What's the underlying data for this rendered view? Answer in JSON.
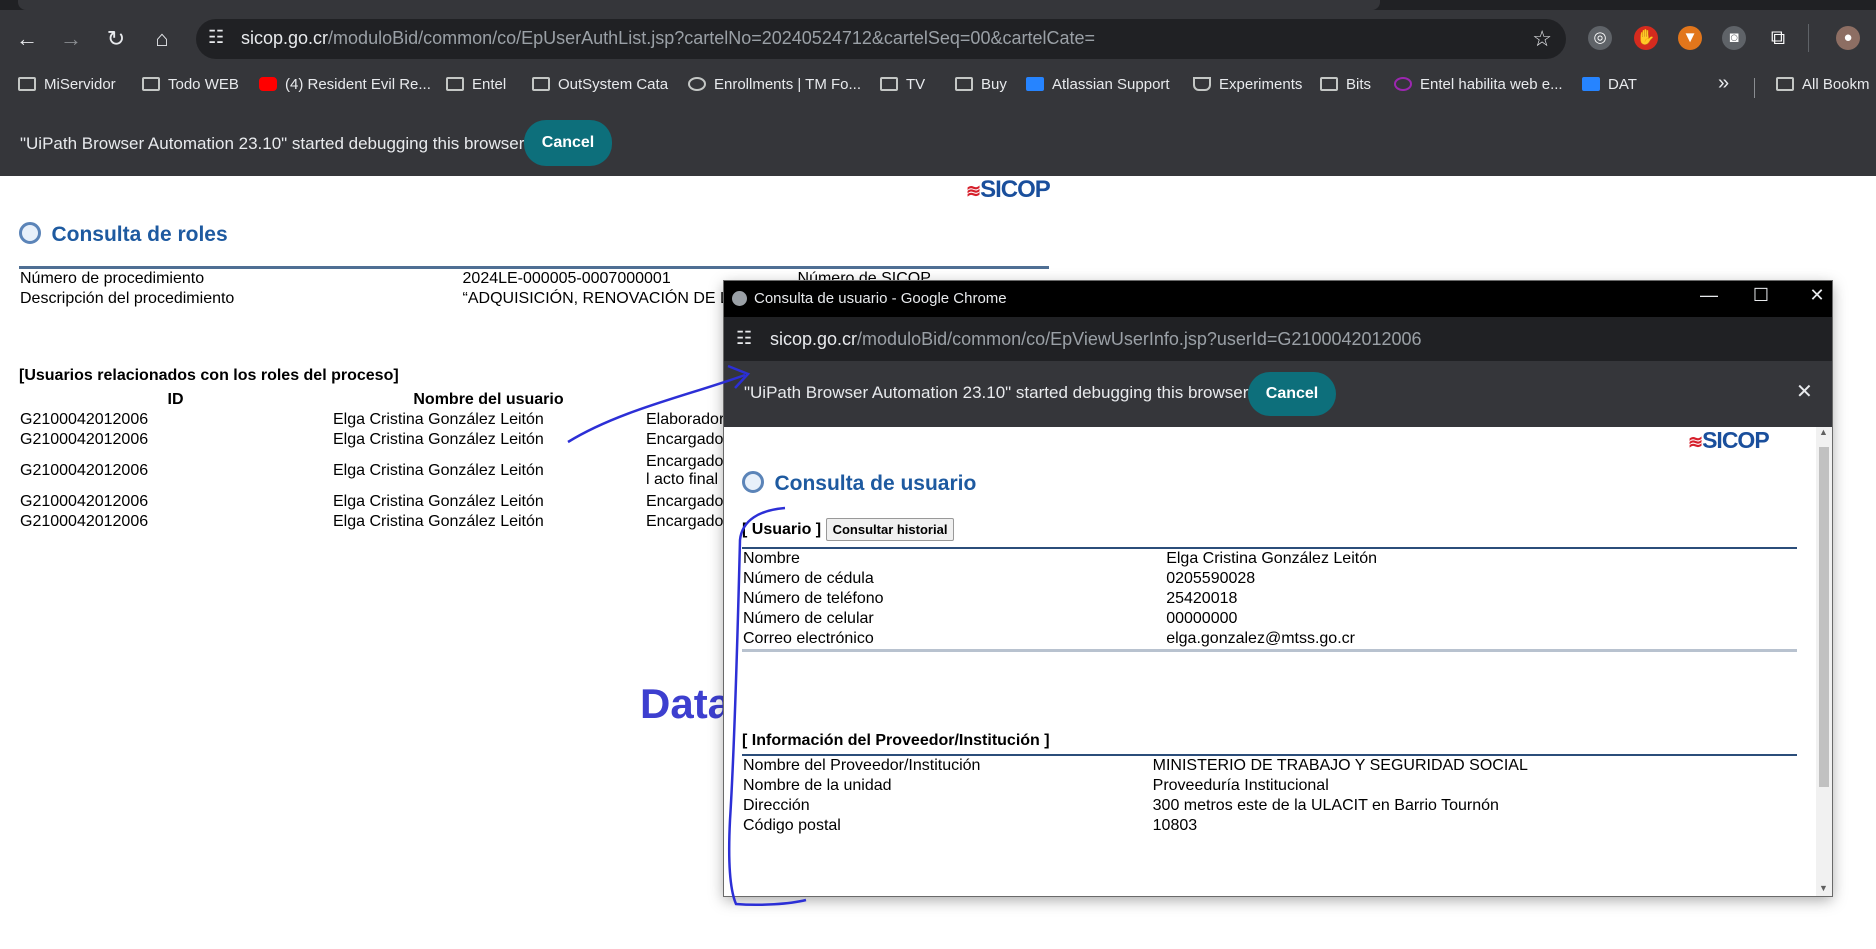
{
  "browser": {
    "url_host": "sicop.go.cr",
    "url_path": "/moduloBid/common/co/EpUserAuthList.jsp?cartelNo=20240524712&cartelSeq=00&cartelCate=",
    "bookmarks": [
      "MiServidor",
      "Todo WEB",
      "(4) Resident Evil Re...",
      "Entel",
      "OutSystem Cata",
      "Enrollments | TM Fo...",
      "TV",
      "Buy",
      "Atlassian Support",
      "Experiments",
      "Bits",
      "Entel habilita web e...",
      "DAT",
      "All Bookm"
    ],
    "bookmarks_more": "»",
    "infobar_text": "\"UiPath Browser Automation 23.10\" started debugging this browser",
    "cancel_label": "Cancel"
  },
  "page": {
    "logo": "SICOP",
    "title": "Consulta de roles",
    "procedure": {
      "num_label": "Número de procedimiento",
      "num_value": "2024LE-000005-0007000001",
      "sicop_label": "Número de SICOP",
      "desc_label": "Descripción del procedimiento",
      "desc_value": "“ADQUISICIÓN, RENOVACIÓN DE LICENCIAS DE LASERFICHE Y HORAS"
    },
    "users_section_title": "[Usuarios relacionados con los roles del proceso]",
    "users_headers": [
      "ID",
      "Nombre del usuario"
    ],
    "users_rows": [
      {
        "id": "G2100042012006",
        "name": "Elga Cristina González Leitón",
        "role": "Elaborador"
      },
      {
        "id": "G2100042012006",
        "name": "Elga Cristina González Leitón",
        "role": "Encargado c"
      },
      {
        "id": "G2100042012006",
        "name": "Elga Cristina González Leitón",
        "role": "Encargado c",
        "role2": "l acto final"
      },
      {
        "id": "G2100042012006",
        "name": "Elga Cristina González Leitón",
        "role": "Encargado c"
      },
      {
        "id": "G2100042012006",
        "name": "Elga Cristina González Leitón",
        "role": "Encargado c"
      }
    ],
    "annotation_text": "Data"
  },
  "popup": {
    "window_title": "Consulta de usuario - Google Chrome",
    "url_host": "sicop.go.cr",
    "url_path": "/moduloBid/common/co/EpViewUserInfo.jsp?userId=G2100042012006",
    "infobar_text": "\"UiPath Browser Automation 23.10\" started debugging this browser",
    "cancel_label": "Cancel",
    "logo": "SICOP",
    "title": "Consulta de usuario",
    "user_section": "[ Usuario ]",
    "history_button": "Consultar historial",
    "user_fields": [
      {
        "label": "Nombre",
        "value": "Elga Cristina González Leitón"
      },
      {
        "label": "Número de cédula",
        "value": "0205590028"
      },
      {
        "label": "Número de teléfono",
        "value": "25420018"
      },
      {
        "label": "Número de celular",
        "value": "00000000"
      },
      {
        "label": "Correo electrónico",
        "value": "elga.gonzalez@mtss.go.cr"
      }
    ],
    "provider_section": "[ Información del Proveedor/Institución ]",
    "provider_fields": [
      {
        "label": "Nombre del Proveedor/Institución",
        "value": "MINISTERIO DE TRABAJO Y SEGURIDAD SOCIAL"
      },
      {
        "label": "Nombre de la unidad",
        "value": "Proveeduría Institucional"
      },
      {
        "label": "Dirección",
        "value": "300 metros este de la ULACIT en Barrio Tournón"
      },
      {
        "label": "Código postal",
        "value": "10803"
      }
    ]
  },
  "colors": {
    "accent_button": "#0d6f7b",
    "id_red": "#d51e24",
    "name_blue": "#1c3f97",
    "annotation_blue": "#2c2fd6"
  }
}
